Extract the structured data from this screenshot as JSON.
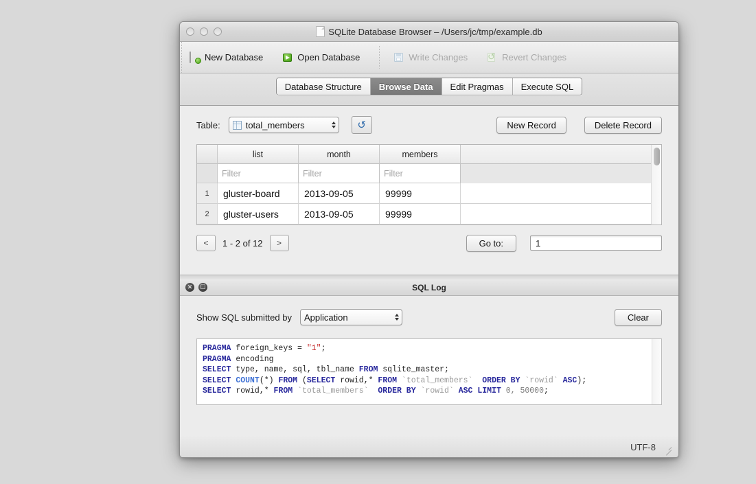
{
  "window": {
    "title": "SQLite Database Browser – /Users/jc/tmp/example.db",
    "doc_icon": "document-icon"
  },
  "toolbar": {
    "items": [
      {
        "label": "New Database",
        "icon": "new-database-icon",
        "enabled": true
      },
      {
        "label": "Open Database",
        "icon": "open-database-icon",
        "enabled": true
      },
      {
        "label": "Write Changes",
        "icon": "write-changes-icon",
        "enabled": false
      },
      {
        "label": "Revert Changes",
        "icon": "revert-changes-icon",
        "enabled": false
      }
    ]
  },
  "tabs": [
    {
      "label": "Database Structure",
      "active": false
    },
    {
      "label": "Browse Data",
      "active": true
    },
    {
      "label": "Edit Pragmas",
      "active": false
    },
    {
      "label": "Execute SQL",
      "active": false
    }
  ],
  "browse": {
    "table_label": "Table:",
    "table_value": "total_members",
    "refresh_icon": "refresh-icon",
    "new_record_label": "New Record",
    "delete_record_label": "Delete Record",
    "grid": {
      "columns": [
        "list",
        "month",
        "members"
      ],
      "filter_placeholder": "Filter",
      "rows": [
        {
          "num": "1",
          "list": "gluster-board",
          "month": "2013-09-05",
          "members": "99999"
        },
        {
          "num": "2",
          "list": "gluster-users",
          "month": "2013-09-05",
          "members": "99999"
        }
      ]
    },
    "pagination": {
      "prev_label": "<",
      "next_label": ">",
      "range_text": "1 - 2 of 12",
      "goto_label": "Go to:",
      "goto_value": "1"
    }
  },
  "sql_log": {
    "panel_title": "SQL Log",
    "close_icon": "close-icon",
    "float_icon": "undock-icon",
    "show_label": "Show SQL submitted by",
    "source_value": "Application",
    "clear_label": "Clear",
    "lines": [
      [
        {
          "t": "PRAGMA",
          "c": "kw"
        },
        {
          "t": " foreign_keys = ",
          "c": ""
        },
        {
          "t": "\"1\"",
          "c": "str"
        },
        {
          "t": ";",
          "c": ""
        }
      ],
      [
        {
          "t": "PRAGMA",
          "c": "kw"
        },
        {
          "t": " encoding",
          "c": ""
        }
      ],
      [
        {
          "t": "SELECT",
          "c": "kw"
        },
        {
          "t": " type, name, sql, tbl_name ",
          "c": ""
        },
        {
          "t": "FROM",
          "c": "kw"
        },
        {
          "t": " sqlite_master;",
          "c": ""
        }
      ],
      [
        {
          "t": "SELECT",
          "c": "kw"
        },
        {
          "t": " ",
          "c": ""
        },
        {
          "t": "COUNT",
          "c": "fn"
        },
        {
          "t": "(*) ",
          "c": ""
        },
        {
          "t": "FROM",
          "c": "kw"
        },
        {
          "t": " (",
          "c": ""
        },
        {
          "t": "SELECT",
          "c": "kw"
        },
        {
          "t": " rowid,* ",
          "c": ""
        },
        {
          "t": "FROM",
          "c": "kw"
        },
        {
          "t": " `total_members`",
          "c": "idt"
        },
        {
          "t": "  ",
          "c": ""
        },
        {
          "t": "ORDER BY",
          "c": "kw"
        },
        {
          "t": " `rowid` ",
          "c": "idt"
        },
        {
          "t": "ASC",
          "c": "kw"
        },
        {
          "t": ");",
          "c": ""
        }
      ],
      [
        {
          "t": "SELECT",
          "c": "kw"
        },
        {
          "t": " rowid,* ",
          "c": ""
        },
        {
          "t": "FROM",
          "c": "kw"
        },
        {
          "t": " `total_members`",
          "c": "idt"
        },
        {
          "t": "  ",
          "c": ""
        },
        {
          "t": "ORDER BY",
          "c": "kw"
        },
        {
          "t": " `rowid` ",
          "c": "idt"
        },
        {
          "t": "ASC LIMIT",
          "c": "kw"
        },
        {
          "t": " ",
          "c": ""
        },
        {
          "t": "0, 50000",
          "c": "num"
        },
        {
          "t": ";",
          "c": ""
        }
      ]
    ]
  },
  "statusbar": {
    "encoding": "UTF-8",
    "grip_icon": "resize-grip-icon"
  }
}
